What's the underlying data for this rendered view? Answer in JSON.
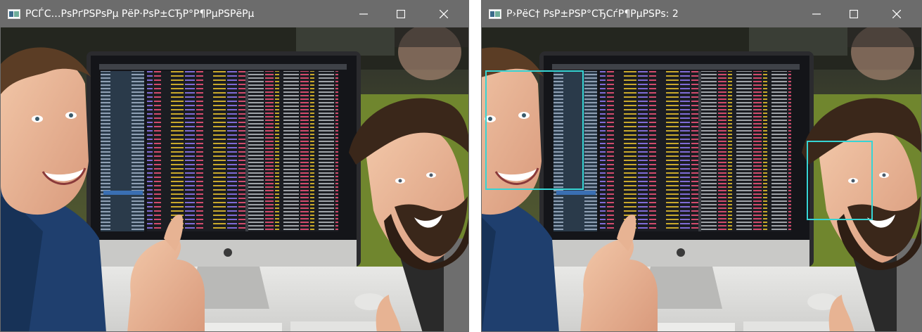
{
  "windows": [
    {
      "title": "РСЃС…РѕРґРЅРѕРµ РёР·РѕР±СЂР°Р¶РµРЅРёРµ",
      "controls": [
        "minimize-icon",
        "maximize-icon",
        "close-icon"
      ]
    },
    {
      "title": "Р›РёС† РѕР±РЅР°СЂСѓР¶РµРЅРѕ: 2",
      "controls": [
        "minimize-icon",
        "maximize-icon",
        "close-icon"
      ],
      "detection_color": "#36d4d4"
    }
  ],
  "colors": {
    "titlebar": "#6c6c6c",
    "title_text": "#ffffff",
    "detection_box": "#36d4d4"
  }
}
